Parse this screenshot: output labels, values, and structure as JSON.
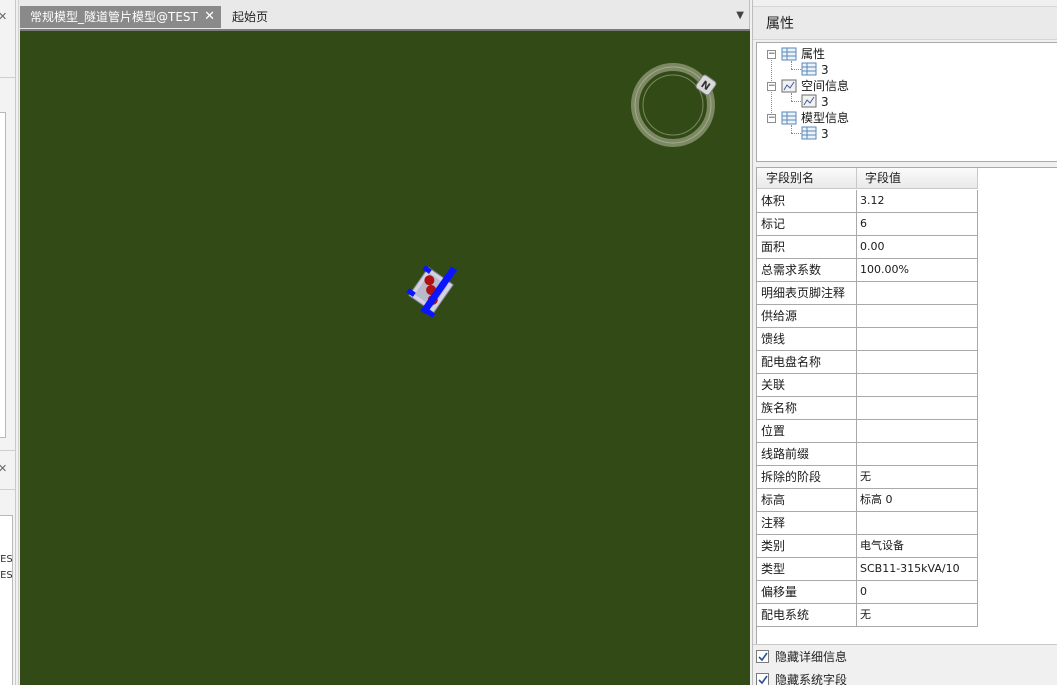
{
  "left_panel": {
    "snippets": [
      "TES",
      "TES"
    ]
  },
  "tabs": [
    {
      "label": "常规模型_隧道管片模型@TEST",
      "active": true,
      "close": "✕"
    },
    {
      "label": "起始页",
      "active": false
    }
  ],
  "tab_menu_icon": "dropdown-arrow-icon",
  "viewport": {
    "background_color": "#324b16",
    "compass_label": "N"
  },
  "properties": {
    "title": "属性",
    "tree": [
      {
        "label": "属性",
        "child": "3"
      },
      {
        "label": "空间信息",
        "child": "3"
      },
      {
        "label": "模型信息",
        "child": "3"
      }
    ],
    "grid": {
      "headers": {
        "name": "字段别名",
        "value": "字段值"
      },
      "rows": [
        {
          "name": "体积",
          "value": "3.12"
        },
        {
          "name": "标记",
          "value": "6"
        },
        {
          "name": "面积",
          "value": "0.00"
        },
        {
          "name": "总需求系数",
          "value": "100.00%"
        },
        {
          "name": "明细表页脚注释",
          "value": ""
        },
        {
          "name": "供给源",
          "value": ""
        },
        {
          "name": "馈线",
          "value": ""
        },
        {
          "name": "配电盘名称",
          "value": ""
        },
        {
          "name": "关联",
          "value": ""
        },
        {
          "name": "族名称",
          "value": ""
        },
        {
          "name": "位置",
          "value": ""
        },
        {
          "name": "线路前缀",
          "value": ""
        },
        {
          "name": "拆除的阶段",
          "value": "无"
        },
        {
          "name": "标高",
          "value": "标高 0"
        },
        {
          "name": "注释",
          "value": ""
        },
        {
          "name": "类别",
          "value": "电气设备"
        },
        {
          "name": "类型",
          "value": "SCB11-315kVA/10"
        },
        {
          "name": "偏移量",
          "value": "0"
        },
        {
          "name": "配电系统",
          "value": "无"
        }
      ]
    },
    "checkboxes": [
      {
        "label": "隐藏详细信息",
        "checked": true
      },
      {
        "label": "隐藏系统字段",
        "checked": true
      }
    ]
  }
}
